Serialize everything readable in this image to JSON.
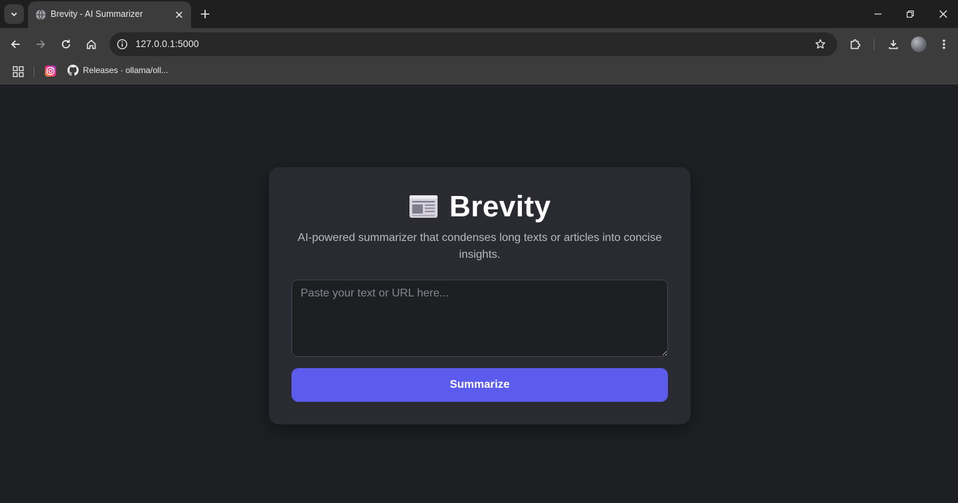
{
  "browser": {
    "tab": {
      "title": "Brevity - AI Summarizer"
    },
    "address_bar": {
      "url": "127.0.0.1:5000"
    },
    "bookmarks": [
      {
        "icon": "instagram-icon",
        "label": ""
      },
      {
        "icon": "github-icon",
        "label": "Releases · ollama/oll..."
      }
    ]
  },
  "app": {
    "title": "Brevity",
    "logo_icon": "newspaper-icon",
    "subtitle": "AI-powered summarizer that condenses long texts or articles into concise insights.",
    "input": {
      "placeholder": "Paste your text or URL here...",
      "value": ""
    },
    "summarize_label": "Summarize"
  },
  "colors": {
    "page_background": "#1e1f23",
    "card_background": "#2a2b31",
    "accent": "#5b5ced"
  }
}
